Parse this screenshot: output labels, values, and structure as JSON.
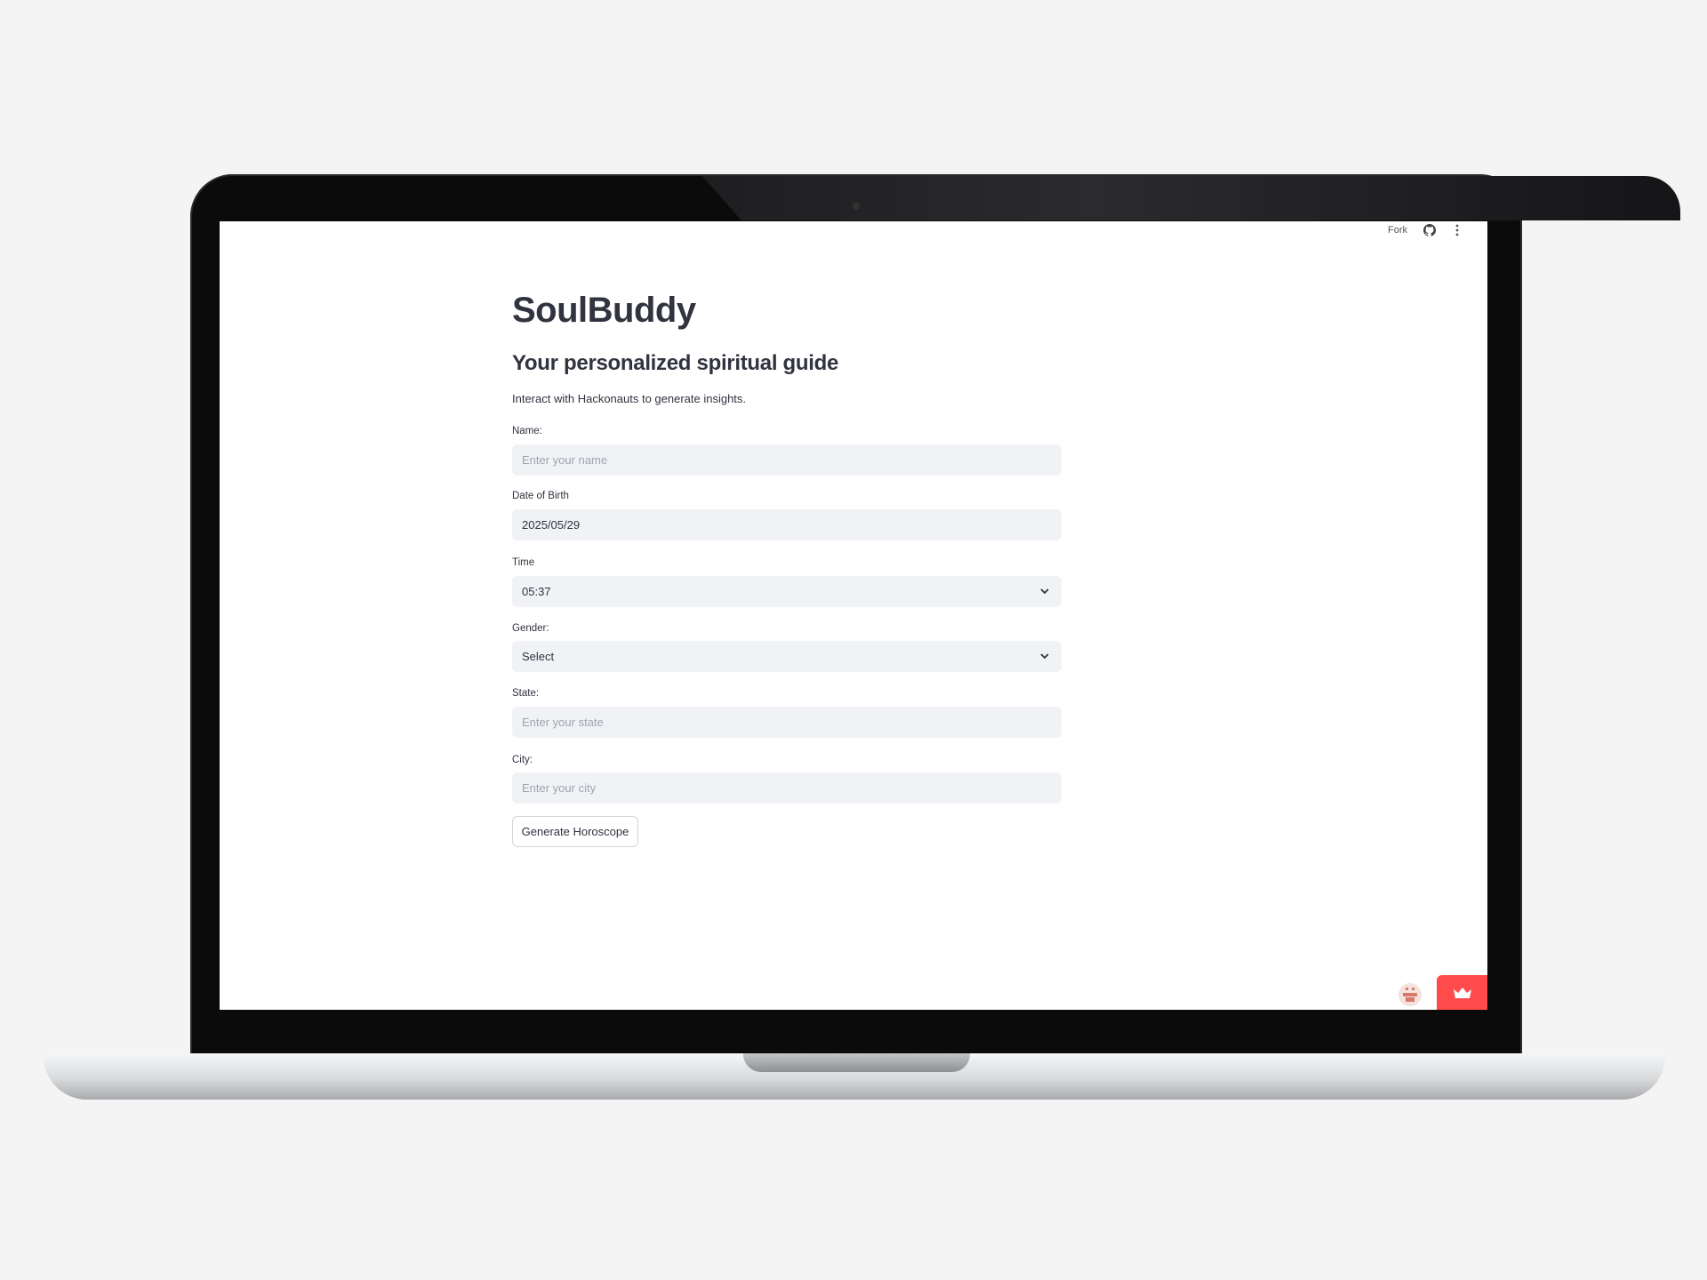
{
  "header": {
    "fork_label": "Fork",
    "icons": [
      "github-icon",
      "more-vertical-icon"
    ]
  },
  "main": {
    "title": "SoulBuddy",
    "subtitle": "Your personalized spiritual guide",
    "description": "Interact with Hackonauts to generate insights.",
    "fields": {
      "name": {
        "label": "Name:",
        "placeholder": "Enter your name",
        "value": ""
      },
      "dob": {
        "label": "Date of Birth",
        "value": "2025/05/29"
      },
      "time": {
        "label": "Time",
        "value": "05:37"
      },
      "gender": {
        "label": "Gender:",
        "value": "Select"
      },
      "state": {
        "label": "State:",
        "placeholder": "Enter your state",
        "value": ""
      },
      "city": {
        "label": "City:",
        "placeholder": "Enter your city",
        "value": ""
      }
    },
    "button_label": "Generate Horoscope"
  },
  "footer": {
    "icons": [
      "bot-icon",
      "crown-icon"
    ],
    "accent": "#ff4b4b"
  }
}
